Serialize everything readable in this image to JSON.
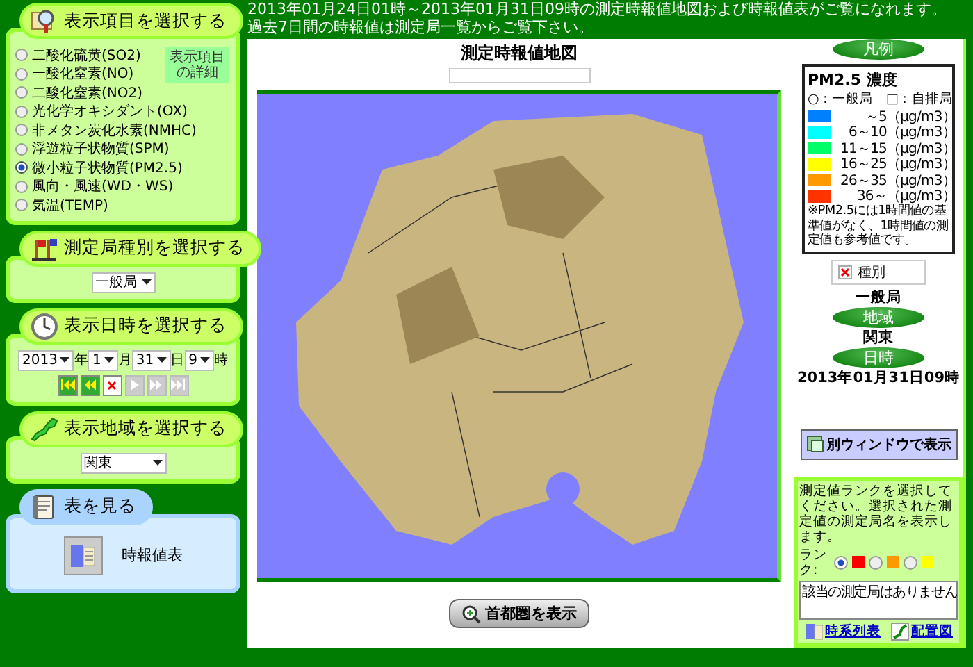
{
  "header": {
    "lines": [
      "2013年01月24日01時～2013年01月31日09時の測定時報値地図および時報値表がご覧になれます。",
      "過去7日間の時報値は測定局一覧からご覧下さい。"
    ]
  },
  "item_panel": {
    "title": "表示項目を選択する",
    "detail_tip": "表示項目の詳細",
    "options": [
      {
        "label": "二酸化硫黄(SO2)",
        "selected": false
      },
      {
        "label": "一酸化窒素(NO)",
        "selected": false
      },
      {
        "label": "二酸化窒素(NO2)",
        "selected": false
      },
      {
        "label": "光化学オキシダント(OX)",
        "selected": false
      },
      {
        "label": "非メタン炭化水素(NMHC)",
        "selected": false
      },
      {
        "label": "浮遊粒子状物質(SPM)",
        "selected": false
      },
      {
        "label": "微小粒子状物質(PM2.5)",
        "selected": true
      },
      {
        "label": "風向・風速(WD・WS)",
        "selected": false
      },
      {
        "label": "気温(TEMP)",
        "selected": false
      }
    ]
  },
  "station_type_panel": {
    "title": "測定局種別を選択する",
    "select": "一般局"
  },
  "datetime_panel": {
    "title": "表示日時を選択する",
    "fields": [
      {
        "value": "2013",
        "unit": "年"
      },
      {
        "value": "1",
        "unit": "月"
      },
      {
        "value": "31",
        "unit": "日"
      },
      {
        "value": "9",
        "unit": "時"
      }
    ],
    "nav_buttons": [
      {
        "kind": "first",
        "disabled": false
      },
      {
        "kind": "prev",
        "disabled": false
      },
      {
        "kind": "stop",
        "disabled": false
      },
      {
        "kind": "play",
        "disabled": true
      },
      {
        "kind": "next",
        "disabled": true
      },
      {
        "kind": "last",
        "disabled": true
      }
    ]
  },
  "region_panel": {
    "title": "表示地域を選択する",
    "select": "関東"
  },
  "table_panel": {
    "title": "表を見る",
    "link": "時報値表"
  },
  "map": {
    "title": "測定時報値地図",
    "button": "首都圏を表示"
  },
  "legend": {
    "heading": "凡例",
    "title": "PM2.5 濃度",
    "station_kinds": "○：一般局　□：自排局",
    "ranks": [
      {
        "range": "～5",
        "unit": "（μg/m3）",
        "color": "#0080ff"
      },
      {
        "range": "6～10",
        "unit": "（μg/m3）",
        "color": "#00ffff"
      },
      {
        "range": "11～15",
        "unit": "（μg/m3）",
        "color": "#00ff66"
      },
      {
        "range": "16～25",
        "unit": "（μg/m3）",
        "color": "#ffff00"
      },
      {
        "range": "26～35",
        "unit": "（μg/m3）",
        "color": "#ff9900"
      },
      {
        "range": "36～",
        "unit": "（μg/m3）",
        "color": "#ff3300"
      }
    ],
    "note": "※PM2.5には1時間値の基準値がなく、1時間値の測定値も参考値です。",
    "kind_label": "種別",
    "kind_value": "一般局",
    "region_heading": "地域",
    "region_value": "関東",
    "time_heading": "日時",
    "time_value": "2013年01月31日09時"
  },
  "popup_button": "別ウィンドウで表示",
  "rank_box": {
    "instruction": "測定値ランクを選択してください。選択された測定値の測定局名を表示します。",
    "label": "ランク:",
    "options": [
      {
        "color": "#ff0000",
        "selected": true
      },
      {
        "color": "#ff9900",
        "selected": false
      },
      {
        "color": "#ffff00",
        "selected": false
      }
    ],
    "result": "該当の測定局はありません",
    "links": [
      "時系列表",
      "配置図"
    ]
  }
}
